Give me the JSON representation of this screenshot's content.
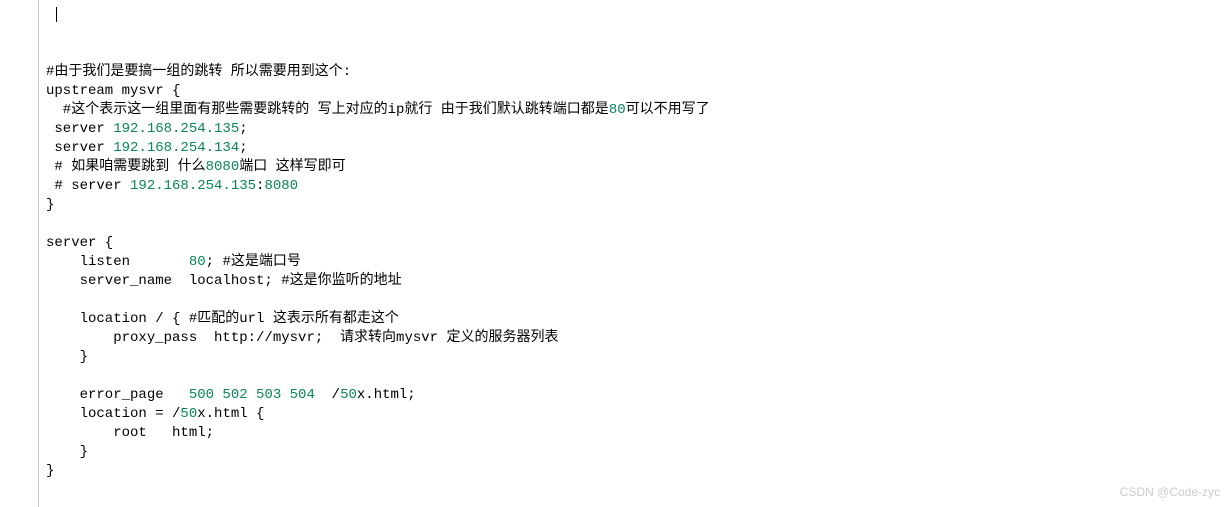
{
  "cursor_line_prefix": " ",
  "lines": [
    {
      "segments": [
        {
          "t": ""
        }
      ]
    },
    {
      "segments": [
        {
          "t": ""
        }
      ]
    },
    {
      "segments": [
        {
          "t": "#由于我们是要搞一组的跳转 所以需要用到这个:"
        }
      ]
    },
    {
      "segments": [
        {
          "t": "upstream mysvr {"
        }
      ]
    },
    {
      "segments": [
        {
          "t": "  #这个表示这一组里面有那些需要跳转的 写上对应的ip就行 由于我们默认跳转端口都是"
        },
        {
          "t": "80",
          "cls": "num"
        },
        {
          "t": "可以不用写了"
        }
      ]
    },
    {
      "segments": [
        {
          "t": " server "
        },
        {
          "t": "192.168.254.135",
          "cls": "num"
        },
        {
          "t": ";"
        }
      ]
    },
    {
      "segments": [
        {
          "t": " server "
        },
        {
          "t": "192.168.254.134",
          "cls": "num"
        },
        {
          "t": ";"
        }
      ]
    },
    {
      "segments": [
        {
          "t": " # 如果咱需要跳到 什么"
        },
        {
          "t": "8080",
          "cls": "num"
        },
        {
          "t": "端口 这样写即可"
        }
      ]
    },
    {
      "segments": [
        {
          "t": " # server "
        },
        {
          "t": "192.168.254.135",
          "cls": "num"
        },
        {
          "t": ":"
        },
        {
          "t": "8080",
          "cls": "num"
        }
      ]
    },
    {
      "segments": [
        {
          "t": "}"
        }
      ]
    },
    {
      "segments": [
        {
          "t": ""
        }
      ]
    },
    {
      "segments": [
        {
          "t": "server {"
        }
      ]
    },
    {
      "segments": [
        {
          "t": "    listen       "
        },
        {
          "t": "80",
          "cls": "num"
        },
        {
          "t": "; #这是端口号"
        }
      ]
    },
    {
      "segments": [
        {
          "t": "    server_name  localhost; #这是你监听的地址"
        }
      ]
    },
    {
      "segments": [
        {
          "t": ""
        }
      ]
    },
    {
      "segments": [
        {
          "t": "    location / { #匹配的url 这表示所有都走这个"
        }
      ]
    },
    {
      "segments": [
        {
          "t": "        proxy_pass  http://mysvr;  请求转向mysvr 定义的服务器列表"
        }
      ]
    },
    {
      "segments": [
        {
          "t": "    }"
        }
      ]
    },
    {
      "segments": [
        {
          "t": ""
        }
      ]
    },
    {
      "segments": [
        {
          "t": "    error_page   "
        },
        {
          "t": "500 502 503 504",
          "cls": "num"
        },
        {
          "t": "  /"
        },
        {
          "t": "50",
          "cls": "num"
        },
        {
          "t": "x.html;"
        }
      ]
    },
    {
      "segments": [
        {
          "t": "    location = /"
        },
        {
          "t": "50",
          "cls": "num"
        },
        {
          "t": "x.html {"
        }
      ]
    },
    {
      "segments": [
        {
          "t": "        root   html;"
        }
      ]
    },
    {
      "segments": [
        {
          "t": "    }"
        }
      ]
    },
    {
      "segments": [
        {
          "t": "}"
        }
      ]
    }
  ],
  "watermark": "CSDN @Code-zyc"
}
